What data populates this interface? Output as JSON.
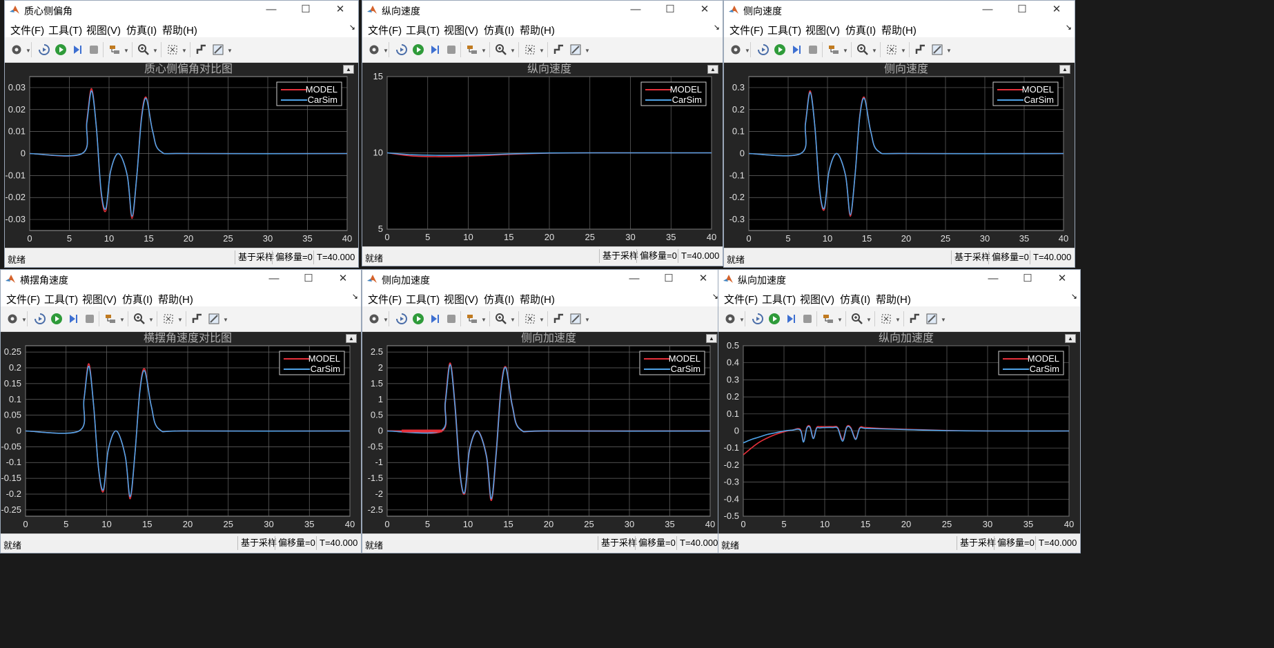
{
  "menus": [
    "文件(F)",
    "工具(T)",
    "视图(V)",
    "仿真(I)",
    "帮助(H)"
  ],
  "status": {
    "ready": "就绪",
    "mode": "基于采样",
    "offset": "偏移量=0",
    "time": "T=40.000"
  },
  "legend": [
    "MODEL",
    "CarSim"
  ],
  "colors": {
    "model": "#e8303a",
    "carsim": "#4fa3e8",
    "plot_bg": "#000000",
    "grid": "#6a6a6a"
  },
  "windows": [
    {
      "title": "质心侧偏角",
      "plot_title": "质心侧偏角对比图"
    },
    {
      "title": "纵向速度",
      "plot_title": "纵向速度"
    },
    {
      "title": "侧向速度",
      "plot_title": "侧向速度"
    },
    {
      "title": "横摆角速度",
      "plot_title": "横摆角速度对比图"
    },
    {
      "title": "侧向加速度",
      "plot_title": "侧向加速度"
    },
    {
      "title": "纵向加速度",
      "plot_title": "纵向加速度"
    }
  ],
  "chart_data": [
    {
      "type": "line",
      "title": "质心侧偏角对比图",
      "xlim": [
        0,
        40
      ],
      "ylim": [
        -0.035,
        0.035
      ],
      "xticks": [
        0,
        5,
        10,
        15,
        20,
        25,
        30,
        35,
        40
      ],
      "yticks": [
        -0.03,
        -0.02,
        -0.01,
        0,
        0.01,
        0.02,
        0.03
      ],
      "yticklabels": [
        "-0.03",
        "-0.02",
        "-0.01",
        "0",
        "0.01",
        "0.02",
        "0.03"
      ],
      "grid": true,
      "legend_position": "top-right",
      "series": [
        {
          "name": "MODEL",
          "x": [
            0,
            6.6,
            7.2,
            7.8,
            8.4,
            9,
            9.6,
            10.2,
            11.2,
            12.3,
            12.9,
            13.5,
            14.1,
            14.7,
            15.5,
            16.5,
            20,
            40
          ],
          "y": [
            0,
            0,
            0.015,
            0.0295,
            0.012,
            -0.018,
            -0.026,
            -0.008,
            0,
            -0.01,
            -0.0295,
            -0.01,
            0.017,
            0.0255,
            0.01,
            0.001,
            0,
            0
          ]
        },
        {
          "name": "CarSim",
          "x": [
            0,
            6.6,
            7.2,
            7.8,
            8.4,
            9,
            9.6,
            10.2,
            11.2,
            12.3,
            12.9,
            13.5,
            14.1,
            14.7,
            15.5,
            16.5,
            20,
            40
          ],
          "y": [
            0,
            0,
            0.014,
            0.0285,
            0.012,
            -0.017,
            -0.025,
            -0.008,
            0,
            -0.01,
            -0.0285,
            -0.01,
            0.016,
            0.025,
            0.01,
            0.001,
            0,
            0
          ]
        }
      ]
    },
    {
      "type": "line",
      "title": "纵向速度",
      "xlim": [
        0,
        40
      ],
      "ylim": [
        5,
        15
      ],
      "xticks": [
        0,
        5,
        10,
        15,
        20,
        25,
        30,
        35,
        40
      ],
      "yticks": [
        5,
        10,
        15
      ],
      "yticklabels": [
        "5",
        "10",
        "15"
      ],
      "grid": true,
      "legend_position": "top-right",
      "series": [
        {
          "name": "MODEL",
          "x": [
            0,
            3,
            6,
            9,
            12,
            15,
            20,
            25,
            30,
            40
          ],
          "y": [
            10,
            9.8,
            9.75,
            9.77,
            9.82,
            9.9,
            9.98,
            10,
            10,
            10
          ]
        },
        {
          "name": "CarSim",
          "x": [
            0,
            3,
            6,
            9,
            12,
            15,
            20,
            25,
            30,
            40
          ],
          "y": [
            10,
            9.88,
            9.84,
            9.85,
            9.88,
            9.93,
            9.99,
            10,
            10,
            10
          ]
        }
      ]
    },
    {
      "type": "line",
      "title": "侧向速度",
      "xlim": [
        0,
        40
      ],
      "ylim": [
        -0.35,
        0.35
      ],
      "xticks": [
        0,
        5,
        10,
        15,
        20,
        25,
        30,
        35,
        40
      ],
      "yticks": [
        -0.3,
        -0.2,
        -0.1,
        0,
        0.1,
        0.2,
        0.3
      ],
      "yticklabels": [
        "-0.3",
        "-0.2",
        "-0.1",
        "0",
        "0.1",
        "0.2",
        "0.3"
      ],
      "grid": true,
      "legend_position": "top-right",
      "series": [
        {
          "name": "MODEL",
          "x": [
            0,
            6.6,
            7.2,
            7.8,
            8.4,
            9,
            9.6,
            10.2,
            11.2,
            12.3,
            12.9,
            13.5,
            14.1,
            14.7,
            15.5,
            16.5,
            20,
            40
          ],
          "y": [
            0,
            0,
            0.14,
            0.285,
            0.12,
            -0.17,
            -0.255,
            -0.08,
            0,
            -0.1,
            -0.285,
            -0.1,
            0.17,
            0.255,
            0.1,
            0.01,
            0,
            0
          ]
        },
        {
          "name": "CarSim",
          "x": [
            0,
            6.6,
            7.2,
            7.8,
            8.4,
            9,
            9.6,
            10.2,
            11.2,
            12.3,
            12.9,
            13.5,
            14.1,
            14.7,
            15.5,
            16.5,
            20,
            40
          ],
          "y": [
            0,
            0,
            0.135,
            0.278,
            0.12,
            -0.165,
            -0.248,
            -0.08,
            0,
            -0.1,
            -0.278,
            -0.1,
            0.165,
            0.25,
            0.1,
            0.01,
            0,
            0
          ]
        }
      ]
    },
    {
      "type": "line",
      "title": "横摆角速度对比图",
      "xlim": [
        0,
        40
      ],
      "ylim": [
        -0.27,
        0.27
      ],
      "xticks": [
        0,
        5,
        10,
        15,
        20,
        25,
        30,
        35,
        40
      ],
      "yticks": [
        -0.25,
        -0.2,
        -0.15,
        -0.1,
        -0.05,
        0,
        0.05,
        0.1,
        0.15,
        0.2,
        0.25
      ],
      "yticklabels": [
        "-0.25",
        "-0.2",
        "-0.15",
        "-0.1",
        "-0.05",
        "0",
        "0.05",
        "0.1",
        "0.15",
        "0.2",
        "0.25"
      ],
      "grid": true,
      "legend_position": "top-right",
      "series": [
        {
          "name": "MODEL",
          "x": [
            0,
            6.6,
            7.2,
            7.8,
            8.4,
            9,
            9.6,
            10.2,
            11.2,
            12.3,
            12.9,
            13.5,
            14.1,
            14.7,
            15.5,
            16.5,
            20,
            40
          ],
          "y": [
            0,
            0,
            0.1,
            0.213,
            0.08,
            -0.12,
            -0.192,
            -0.06,
            0,
            -0.08,
            -0.215,
            -0.07,
            0.13,
            0.196,
            0.08,
            0.005,
            0,
            0
          ]
        },
        {
          "name": "CarSim",
          "x": [
            0,
            6.6,
            7.2,
            7.8,
            8.4,
            9,
            9.6,
            10.2,
            11.2,
            12.3,
            12.9,
            13.5,
            14.1,
            14.7,
            15.5,
            16.5,
            20,
            40
          ],
          "y": [
            0,
            0,
            0.098,
            0.205,
            0.08,
            -0.118,
            -0.186,
            -0.06,
            0,
            -0.08,
            -0.208,
            -0.07,
            0.126,
            0.19,
            0.08,
            0.005,
            0,
            0
          ]
        }
      ]
    },
    {
      "type": "line",
      "title": "侧向加速度",
      "xlim": [
        0,
        40
      ],
      "ylim": [
        -2.7,
        2.7
      ],
      "xticks": [
        0,
        5,
        10,
        15,
        20,
        25,
        30,
        35,
        40
      ],
      "yticks": [
        -2.5,
        -2,
        -1.5,
        -1,
        -0.5,
        0,
        0.5,
        1,
        1.5,
        2,
        2.5
      ],
      "yticklabels": [
        "-2.5",
        "-2",
        "-1.5",
        "-1",
        "-0.5",
        "0",
        "0.5",
        "1",
        "1.5",
        "2",
        "2.5"
      ],
      "grid": true,
      "legend_position": "top-right",
      "series": [
        {
          "name": "MODEL",
          "x": [
            0,
            1.8,
            6.8,
            7.2,
            7.8,
            8.4,
            9,
            9.6,
            10.2,
            11.2,
            12.3,
            12.9,
            13.5,
            14.1,
            14.7,
            15.5,
            16.5,
            20,
            40
          ],
          "y": [
            0,
            0,
            0,
            0.9,
            2.15,
            0.8,
            -1.3,
            -1.98,
            -0.6,
            0,
            -0.8,
            -2.2,
            -0.7,
            1.35,
            2.02,
            0.8,
            0.05,
            0,
            0
          ]
        },
        {
          "name": "CarSim",
          "x": [
            0,
            6.6,
            7.2,
            7.8,
            8.4,
            9,
            9.6,
            10.2,
            11.2,
            12.3,
            12.9,
            13.5,
            14.1,
            14.7,
            15.5,
            16.5,
            20,
            40
          ],
          "y": [
            0,
            0,
            0.9,
            2.1,
            0.8,
            -1.3,
            -1.95,
            -0.6,
            0,
            -0.8,
            -2.15,
            -0.7,
            1.3,
            2,
            0.8,
            0.05,
            0,
            0
          ]
        }
      ]
    },
    {
      "type": "line",
      "title": "纵向加速度",
      "xlim": [
        0,
        40
      ],
      "ylim": [
        -0.5,
        0.5
      ],
      "xticks": [
        0,
        5,
        10,
        15,
        20,
        25,
        30,
        35,
        40
      ],
      "yticks": [
        -0.5,
        -0.4,
        -0.3,
        -0.2,
        -0.1,
        0,
        0.1,
        0.2,
        0.3,
        0.4,
        0.5
      ],
      "yticklabels": [
        "-0.5",
        "-0.4",
        "-0.3",
        "-0.2",
        "-0.1",
        "0",
        "0.1",
        "0.2",
        "0.3",
        "0.4",
        "0.5"
      ],
      "grid": true,
      "legend_position": "top-right",
      "series": [
        {
          "name": "MODEL",
          "x": [
            0,
            1,
            2,
            3,
            4,
            5,
            6,
            7,
            7.4,
            7.8,
            8.2,
            8.6,
            9,
            9.4,
            10,
            11,
            11.6,
            12.2,
            12.7,
            13.2,
            13.8,
            14.3,
            15,
            17,
            20,
            25,
            30,
            40
          ],
          "y": [
            -0.14,
            -0.1,
            -0.065,
            -0.04,
            -0.02,
            -0.005,
            0.005,
            0.01,
            -0.06,
            0.02,
            0.025,
            -0.04,
            0.02,
            0.025,
            0.025,
            0.025,
            0.02,
            -0.05,
            0.025,
            0.02,
            -0.045,
            0.02,
            0.02,
            0.015,
            0.01,
            0.003,
            0,
            0
          ]
        },
        {
          "name": "CarSim",
          "x": [
            0,
            1,
            2,
            3,
            4,
            5,
            6,
            7,
            7.4,
            7.8,
            8.2,
            8.6,
            9,
            9.4,
            10,
            11,
            11.6,
            12.2,
            12.7,
            13.2,
            13.8,
            14.3,
            15,
            17,
            20,
            25,
            30,
            40
          ],
          "y": [
            -0.07,
            -0.05,
            -0.035,
            -0.02,
            -0.01,
            0,
            0.005,
            0.005,
            -0.065,
            0.015,
            0.02,
            -0.045,
            0.015,
            0.018,
            0.02,
            0.02,
            0.015,
            -0.06,
            0.02,
            0.015,
            -0.05,
            0.015,
            0.015,
            0.012,
            0.008,
            0.002,
            0,
            0
          ]
        }
      ]
    }
  ]
}
